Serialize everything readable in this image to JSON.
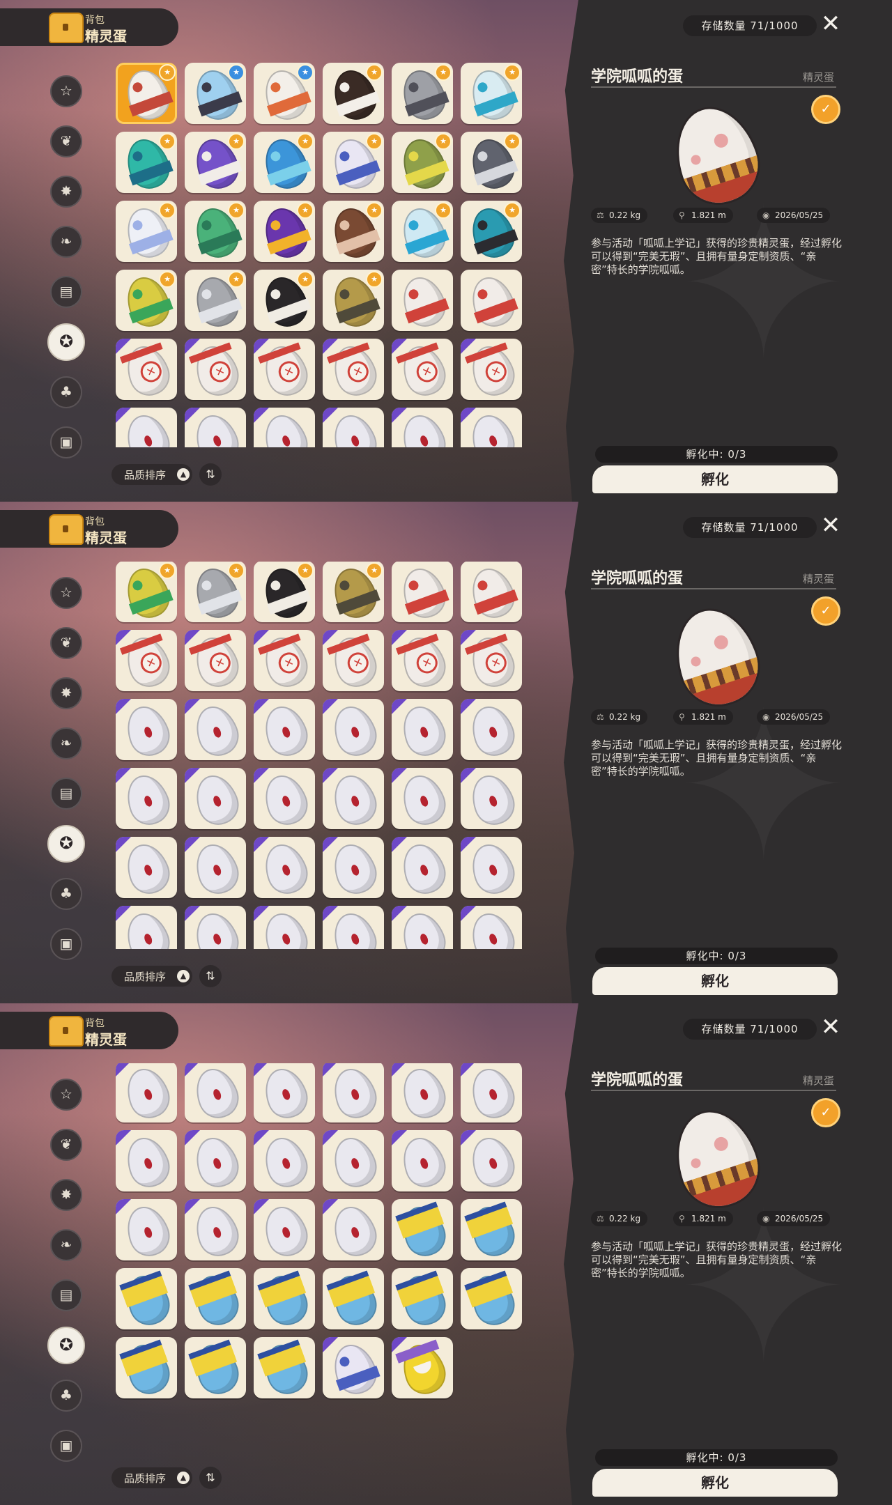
{
  "header": {
    "bag_label": "背包",
    "title": "精灵蛋"
  },
  "storage": {
    "label": "存储数量 71/1000"
  },
  "close_glyph": "✕",
  "nav_icons": [
    "star-ring-icon",
    "leaf-icon",
    "splash-star-icon",
    "plant-icon",
    "scroll-icon",
    "egg-stars-icon",
    "acorn-icon",
    "chest-icon"
  ],
  "nav_glyphs": [
    "☆",
    "❦",
    "✸",
    "❧",
    "▤",
    "✪",
    "♣",
    "▣"
  ],
  "active_nav_index": 5,
  "sort": {
    "label": "品质排序",
    "order_glyph": "▲",
    "toggle_glyph": "⇅"
  },
  "detail": {
    "title": "学院呱呱的蛋",
    "category": "精灵蛋",
    "weight": "0.22 kg",
    "height": "1.821 m",
    "date": "2026/05/25",
    "description": "参与活动「呱呱上学记」获得的珍贵精灵蛋，经过孵化可以得到“完美无瑕”、且拥有量身定制资质、“亲密”特长的学院呱呱。",
    "hatching": "孵化中: 0/3",
    "hatch_button": "孵化"
  },
  "eggs": [
    {
      "base": "#f3efe9",
      "accent": "#c4483a",
      "badge": "gold",
      "sel": true
    },
    {
      "base": "#9fd0ef",
      "accent": "#3b3b4a",
      "badge": "blue"
    },
    {
      "base": "#f3efe9",
      "accent": "#e06a3a",
      "badge": "blue"
    },
    {
      "base": "#3a2b25",
      "accent": "#f3efe9",
      "badge": "gold"
    },
    {
      "base": "#9ea0a6",
      "accent": "#505059",
      "badge": "gold"
    },
    {
      "base": "#d9ecf2",
      "accent": "#2ea7c8",
      "badge": "gold"
    },
    {
      "base": "#2fb8a7",
      "accent": "#1d6e88",
      "badge": "gold"
    },
    {
      "base": "#7552c9",
      "accent": "#f1ede8",
      "badge": "gold"
    },
    {
      "base": "#3c95d9",
      "accent": "#7bd0ea",
      "badge": "gold"
    },
    {
      "base": "#e9e6f3",
      "accent": "#4a5fbf",
      "badge": "gold"
    },
    {
      "base": "#8fa04a",
      "accent": "#e4d84a",
      "badge": "gold"
    },
    {
      "base": "#60636e",
      "accent": "#d6d8dd",
      "badge": "gold"
    },
    {
      "base": "#eef0f6",
      "accent": "#9db0e6",
      "badge": "gold"
    },
    {
      "base": "#4ab27a",
      "accent": "#2a7a58",
      "badge": "gold"
    },
    {
      "base": "#6a36ad",
      "accent": "#f2b22a",
      "badge": "gold"
    },
    {
      "base": "#7a4a33",
      "accent": "#e2c0a8",
      "badge": "gold"
    },
    {
      "base": "#cfe9f3",
      "accent": "#2aa6d3",
      "badge": "gold"
    },
    {
      "base": "#2a9bb1",
      "accent": "#2b2b30",
      "badge": "gold"
    },
    {
      "base": "#d9cc42",
      "accent": "#3aa65a",
      "badge": "gold"
    },
    {
      "base": "#a7a9ae",
      "accent": "#e1e3e8",
      "badge": "gold"
    },
    {
      "base": "#2a2729",
      "accent": "#f0ece4",
      "badge": "gold"
    },
    {
      "base": "#b49a4a",
      "accent": "#4f4a3a",
      "badge": "gold"
    },
    {
      "base": "#f1ece8",
      "accent": "#d0423a",
      "badge": "none"
    },
    {
      "base": "#f1ece8",
      "accent": "#d0423a",
      "badge": "none"
    }
  ],
  "red_cross_egg": {
    "base": "#f1ece8",
    "accent": "#d0423a"
  },
  "white_red_egg": {
    "base": "#e9e8ef",
    "accent": "#b5232f"
  },
  "blue_yellow_egg": {
    "base": "#6fb7e3",
    "accent": "#f0d23a"
  },
  "last_eggs": [
    {
      "base": "#e9e6f3",
      "accent": "#4a5fbf"
    },
    {
      "base": "#f2d52e",
      "accent": "#8a5fc9"
    }
  ]
}
